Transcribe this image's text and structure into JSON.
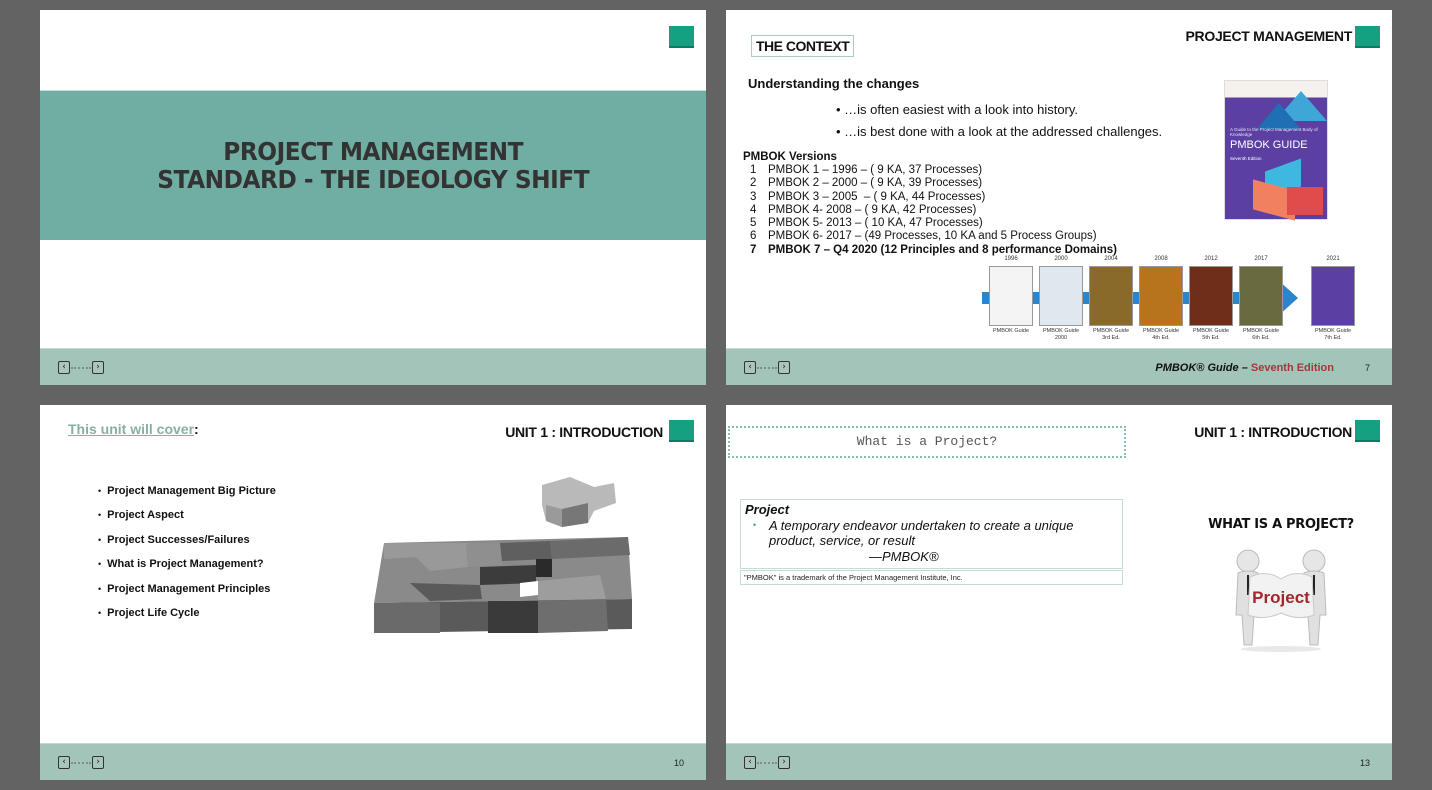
{
  "slides": [
    {
      "title_line1": "PROJECT MANAGEMENT",
      "title_line2": "STANDARD - THE IDEOLOGY SHIFT",
      "nav": {
        "prev": "‹",
        "next": "›"
      }
    },
    {
      "section_label": "THE CONTEXT",
      "header": "PROJECT MANAGEMENT",
      "subheading": "Understanding the changes",
      "bullets": [
        "• …is often easiest with a look into history.",
        "• …is best done with a look at the addressed challenges."
      ],
      "versions_title": "PMBOK Versions",
      "versions": [
        {
          "num": "1",
          "text": "PMBOK 1 – 1996 – ( 9 KA, 37 Processes)"
        },
        {
          "num": "2",
          "text": "PMBOK 2 – 2000 – ( 9 KA, 39 Processes)"
        },
        {
          "num": "3",
          "text": "PMBOK 3 – 2005  – ( 9 KA, 44 Processes)"
        },
        {
          "num": "4",
          "text": "PMBOK 4- 2008 – ( 9 KA, 42 Processes)"
        },
        {
          "num": "5",
          "text": "PMBOK 5- 2013 – ( 10 KA, 47 Processes)"
        },
        {
          "num": "6",
          "text": "PMBOK 6- 2017 – (49 Processes, 10 KA and 5 Process Groups)"
        },
        {
          "num": "7",
          "text": "PMBOK 7 – Q4 2020 (12 Principles and 8 performance Domains)"
        }
      ],
      "cover": {
        "small_text": "A Guide to the Project Management Body of Knowledge",
        "title": "PMBOK GUIDE",
        "edition": "Seventh Edition"
      },
      "timeline": [
        {
          "year": "1996",
          "label1": "PMBOK Guide",
          "label2": "",
          "color": "#f4f4f4"
        },
        {
          "year": "2000",
          "label1": "PMBOK Guide",
          "label2": "2000",
          "color": "#dfe8ef"
        },
        {
          "year": "2004",
          "label1": "PMBOK Guide",
          "label2": "3rd Ed.",
          "color": "#8a6a2a"
        },
        {
          "year": "2008",
          "label1": "PMBOK Guide",
          "label2": "4th Ed.",
          "color": "#b8741c"
        },
        {
          "year": "2012",
          "label1": "PMBOK Guide",
          "label2": "5th Ed.",
          "color": "#6e2e1a"
        },
        {
          "year": "2017",
          "label1": "PMBOK Guide",
          "label2": "6th Ed.",
          "color": "#6a6a40"
        },
        {
          "year": "2021",
          "label1": "PMBOK Guide",
          "label2": "7th Ed.",
          "color": "#5b3fa3"
        }
      ],
      "footer_italic": "PMBOK® Guide – ",
      "footer_red": "Seventh Edition",
      "page": "7",
      "nav": {
        "prev": "‹",
        "next": "›"
      }
    },
    {
      "heading": "This unit will cover",
      "heading_colon": ":",
      "header": "UNIT 1 : INTRODUCTION",
      "items": [
        "Project Management Big Picture",
        "Project Aspect",
        "Project Successes/Failures",
        "What is Project Management?",
        "Project Management Principles",
        "Project Life Cycle"
      ],
      "page": "10",
      "nav": {
        "prev": "‹",
        "next": "›"
      }
    },
    {
      "title": "What is a Project?",
      "header": "UNIT 1 : INTRODUCTION",
      "definition_title": "Project",
      "definition_body": "A temporary endeavor undertaken to create a unique product, service, or result",
      "definition_source": "—PMBOK®",
      "trademark": "\"PMBOK\" is a trademark of the Project Management Institute, Inc.",
      "image_title": "WHAT IS A PROJECT?",
      "image_word": "Project",
      "page": "13",
      "nav": {
        "prev": "‹",
        "next": "›"
      }
    }
  ],
  "colors": {
    "accent": "#16a082",
    "band": "#70ada2",
    "footer": "#a3c4b8",
    "link": "#85b1a2",
    "footer_red": "#a3383a",
    "background": "#636363"
  }
}
